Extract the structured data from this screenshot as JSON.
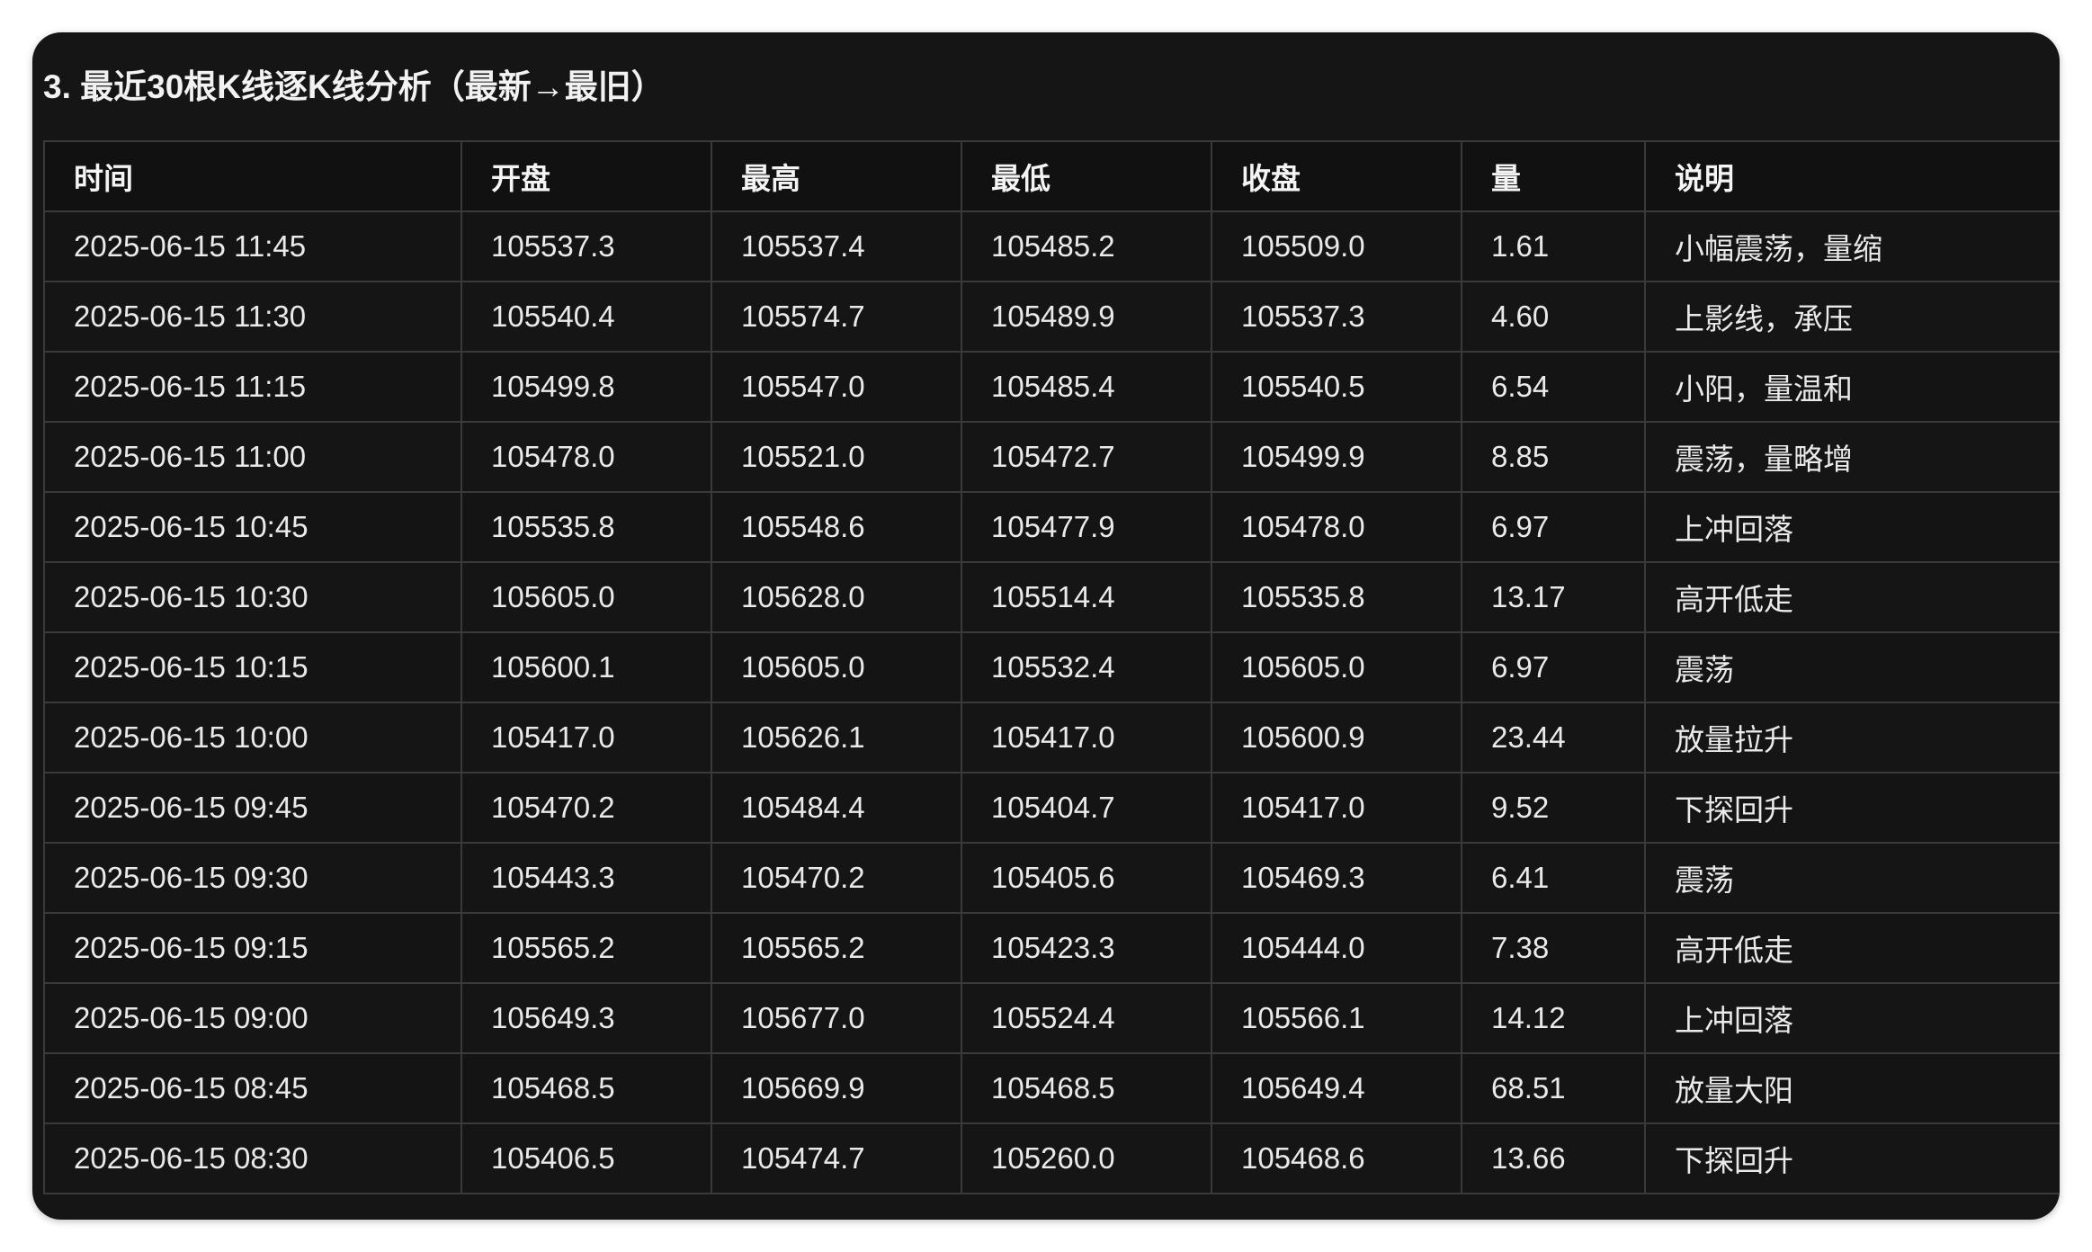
{
  "section_title": "3. 最近30根K线逐K线分析（最新→最旧）",
  "table": {
    "columns": [
      "时间",
      "开盘",
      "最高",
      "最低",
      "收盘",
      "量",
      "说明"
    ],
    "rows": [
      [
        "2025-06-15 11:45",
        "105537.3",
        "105537.4",
        "105485.2",
        "105509.0",
        "1.61",
        "小幅震荡，量缩"
      ],
      [
        "2025-06-15 11:30",
        "105540.4",
        "105574.7",
        "105489.9",
        "105537.3",
        "4.60",
        "上影线，承压"
      ],
      [
        "2025-06-15 11:15",
        "105499.8",
        "105547.0",
        "105485.4",
        "105540.5",
        "6.54",
        "小阳，量温和"
      ],
      [
        "2025-06-15 11:00",
        "105478.0",
        "105521.0",
        "105472.7",
        "105499.9",
        "8.85",
        "震荡，量略增"
      ],
      [
        "2025-06-15 10:45",
        "105535.8",
        "105548.6",
        "105477.9",
        "105478.0",
        "6.97",
        "上冲回落"
      ],
      [
        "2025-06-15 10:30",
        "105605.0",
        "105628.0",
        "105514.4",
        "105535.8",
        "13.17",
        "高开低走"
      ],
      [
        "2025-06-15 10:15",
        "105600.1",
        "105605.0",
        "105532.4",
        "105605.0",
        "6.97",
        "震荡"
      ],
      [
        "2025-06-15 10:00",
        "105417.0",
        "105626.1",
        "105417.0",
        "105600.9",
        "23.44",
        "放量拉升"
      ],
      [
        "2025-06-15 09:45",
        "105470.2",
        "105484.4",
        "105404.7",
        "105417.0",
        "9.52",
        "下探回升"
      ],
      [
        "2025-06-15 09:30",
        "105443.3",
        "105470.2",
        "105405.6",
        "105469.3",
        "6.41",
        "震荡"
      ],
      [
        "2025-06-15 09:15",
        "105565.2",
        "105565.2",
        "105423.3",
        "105444.0",
        "7.38",
        "高开低走"
      ],
      [
        "2025-06-15 09:00",
        "105649.3",
        "105677.0",
        "105524.4",
        "105566.1",
        "14.12",
        "上冲回落"
      ],
      [
        "2025-06-15 08:45",
        "105468.5",
        "105669.9",
        "105468.5",
        "105649.4",
        "68.51",
        "放量大阳"
      ],
      [
        "2025-06-15 08:30",
        "105406.5",
        "105474.7",
        "105260.0",
        "105468.6",
        "13.66",
        "下探回升"
      ]
    ]
  }
}
